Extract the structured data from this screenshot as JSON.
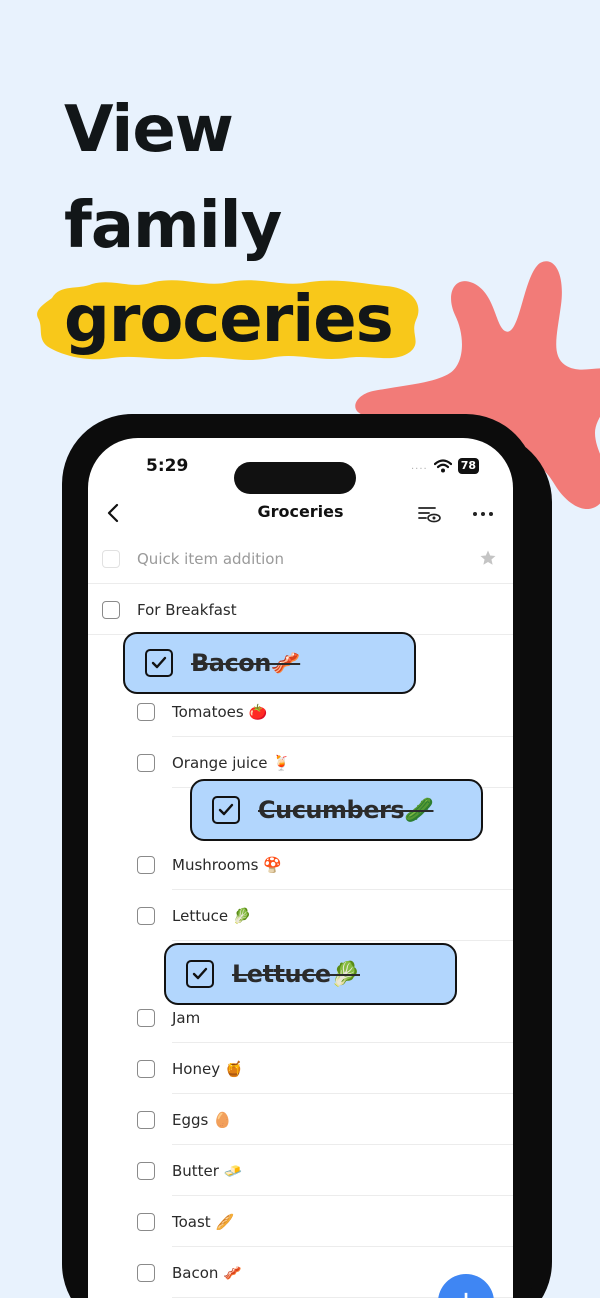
{
  "headline": {
    "line1": "View",
    "line2": "family",
    "line3": "groceries"
  },
  "status": {
    "time": "5:29",
    "signal": "....",
    "battery": "78"
  },
  "nav": {
    "title": "Groceries"
  },
  "quick_add": {
    "placeholder": "Quick item addition"
  },
  "list": {
    "group": "For Breakfast",
    "items": [
      "Tomatoes 🍅",
      "Orange juice 🍹",
      "Mushrooms 🍄",
      "Lettuce 🥬",
      "Jam",
      "Honey 🍯",
      "Eggs 🥚",
      "Butter 🧈",
      "Toast 🥖",
      "Bacon 🥓"
    ]
  },
  "cards": [
    "Bacon🥓",
    "Cucumbers🥒",
    "Lettuce🥬"
  ],
  "fab": {
    "label": "+"
  },
  "colors": {
    "background": "#e8f2fd",
    "highlight": "#f8c81a",
    "splat": "#f27b78",
    "card": "#b2d6fd",
    "fab": "#3f86f3"
  },
  "icons": [
    "back-icon",
    "filter-eye-icon",
    "more-icon",
    "star-icon",
    "wifi-icon",
    "check-icon",
    "plus-icon"
  ]
}
